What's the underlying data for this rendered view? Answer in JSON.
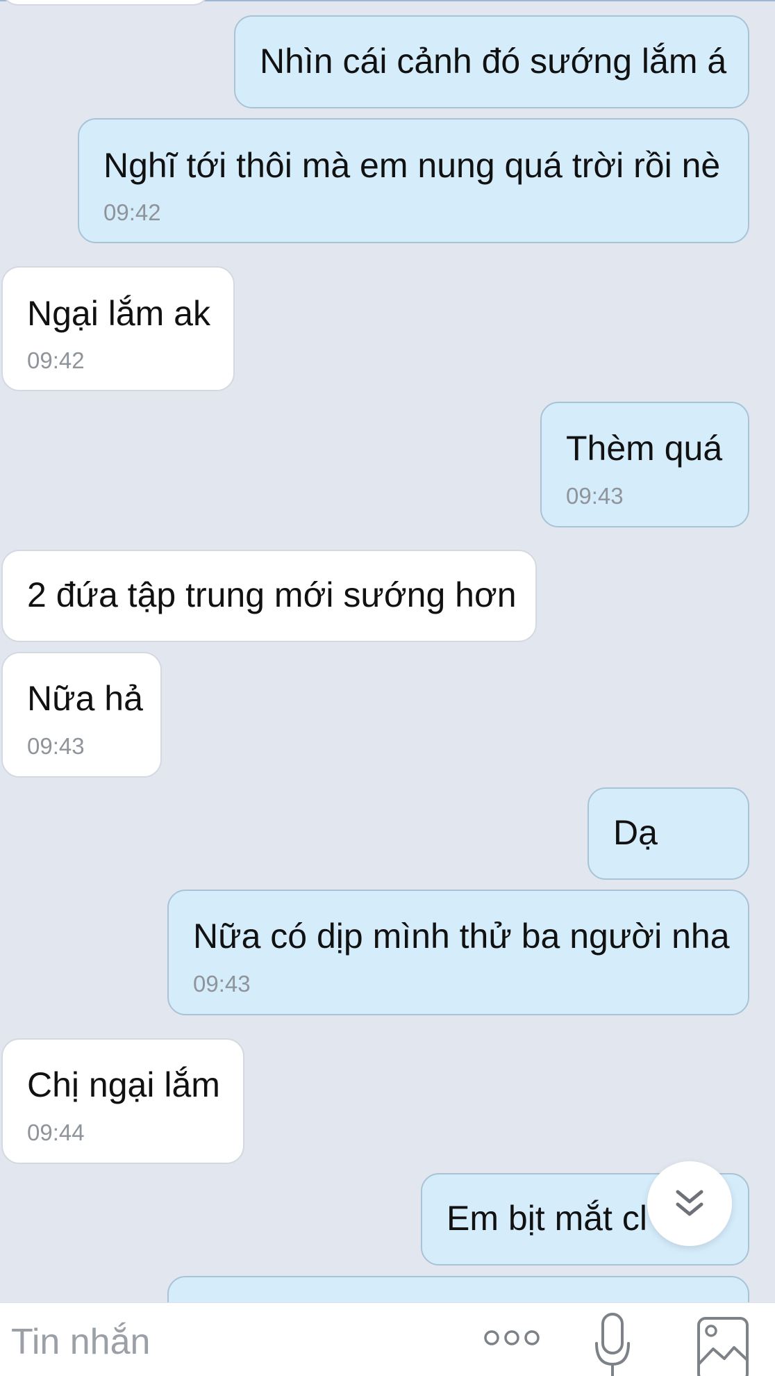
{
  "colors": {
    "background": "#e2e7ef",
    "incoming_bubble": "#ffffff",
    "outgoing_bubble": "#d5ecfb",
    "timestamp": "#8f949b",
    "icon_gray": "#7c8288"
  },
  "messages": [
    {
      "dir": "out",
      "text": "Nhìn cái cảnh đó sướng lắm á",
      "time": ""
    },
    {
      "dir": "out",
      "text": "Nghĩ tới thôi mà em nung quá trời rồi nè",
      "time": "09:42"
    },
    {
      "dir": "in",
      "text": "Ngại lắm ak",
      "time": "09:42"
    },
    {
      "dir": "out",
      "text": "Thèm quá",
      "time": "09:43"
    },
    {
      "dir": "in",
      "text": "2 đứa tập trung mới sướng hơn",
      "time": ""
    },
    {
      "dir": "in",
      "text": "Nữa hả",
      "time": "09:43"
    },
    {
      "dir": "out",
      "text": "Dạ",
      "time": ""
    },
    {
      "dir": "out",
      "text": "Nữa có dịp mình thử ba người nha",
      "time": "09:43"
    },
    {
      "dir": "in",
      "text": "Chị ngại lắm",
      "time": "09:44"
    },
    {
      "dir": "out",
      "text": "Em bịt mắt cl",
      "time": ""
    }
  ],
  "scroll_button": {
    "icon": "double-chevron-down-icon"
  },
  "input_bar": {
    "placeholder": "Tin nhắn",
    "icons": [
      "more-dots-icon",
      "microphone-icon",
      "image-icon"
    ]
  }
}
